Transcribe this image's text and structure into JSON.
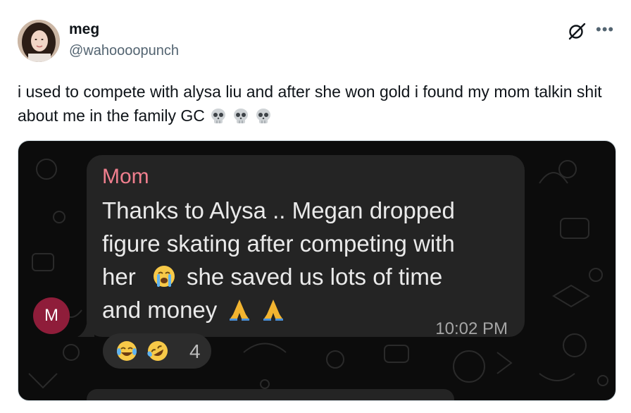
{
  "tweet": {
    "author": {
      "display_name": "meg",
      "handle": "@wahoooopunch"
    },
    "text": "i used to compete with alysa liu and after she won gold i found my mom talkin shit about me in the family GC",
    "trailing_emoji": [
      "skull",
      "skull",
      "skull"
    ],
    "icons": {
      "grok": "grok-icon",
      "more": "more-icon"
    }
  },
  "screenshot": {
    "message": {
      "sender": "Mom",
      "line1": "Thanks to Alysa .. Megan dropped",
      "line2": "figure skating after competing with",
      "line3_before": "her",
      "line3_after": "she saved us lots of time",
      "line4": "and money",
      "inline_emoji": [
        "loudly-crying-face",
        "folded-hands",
        "folded-hands"
      ],
      "time": "10:02 PM"
    },
    "sender_avatar_initial": "M",
    "reactions": {
      "emoji": [
        "face-with-tears-of-joy",
        "rolling-on-floor-laughing"
      ],
      "count": "4"
    }
  },
  "colors": {
    "sender_name": "#f07f8e",
    "bubble": "#242424",
    "avatar_m": "#8f1d3a",
    "handle": "#536471"
  }
}
